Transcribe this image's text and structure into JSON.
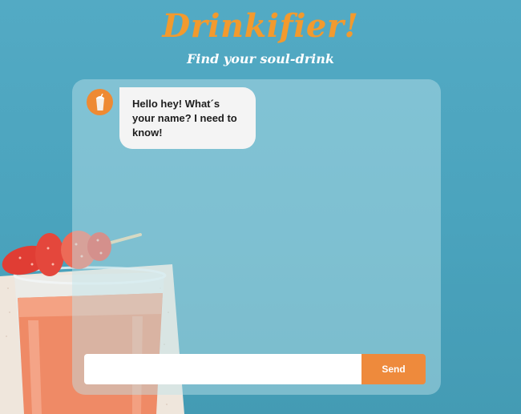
{
  "header": {
    "title": "Drinkifier!",
    "subtitle": "Find your soul-drink"
  },
  "chat": {
    "avatar_icon": "milkshake-icon",
    "messages": [
      {
        "sender": "bot",
        "text": "Hello hey! What´s your name? I need to know!"
      }
    ]
  },
  "composer": {
    "input_value": "",
    "input_placeholder": "",
    "send_label": "Send"
  },
  "colors": {
    "background": "#4aa3bd",
    "accent": "#ee8a3c",
    "title": "#f29a2e"
  }
}
